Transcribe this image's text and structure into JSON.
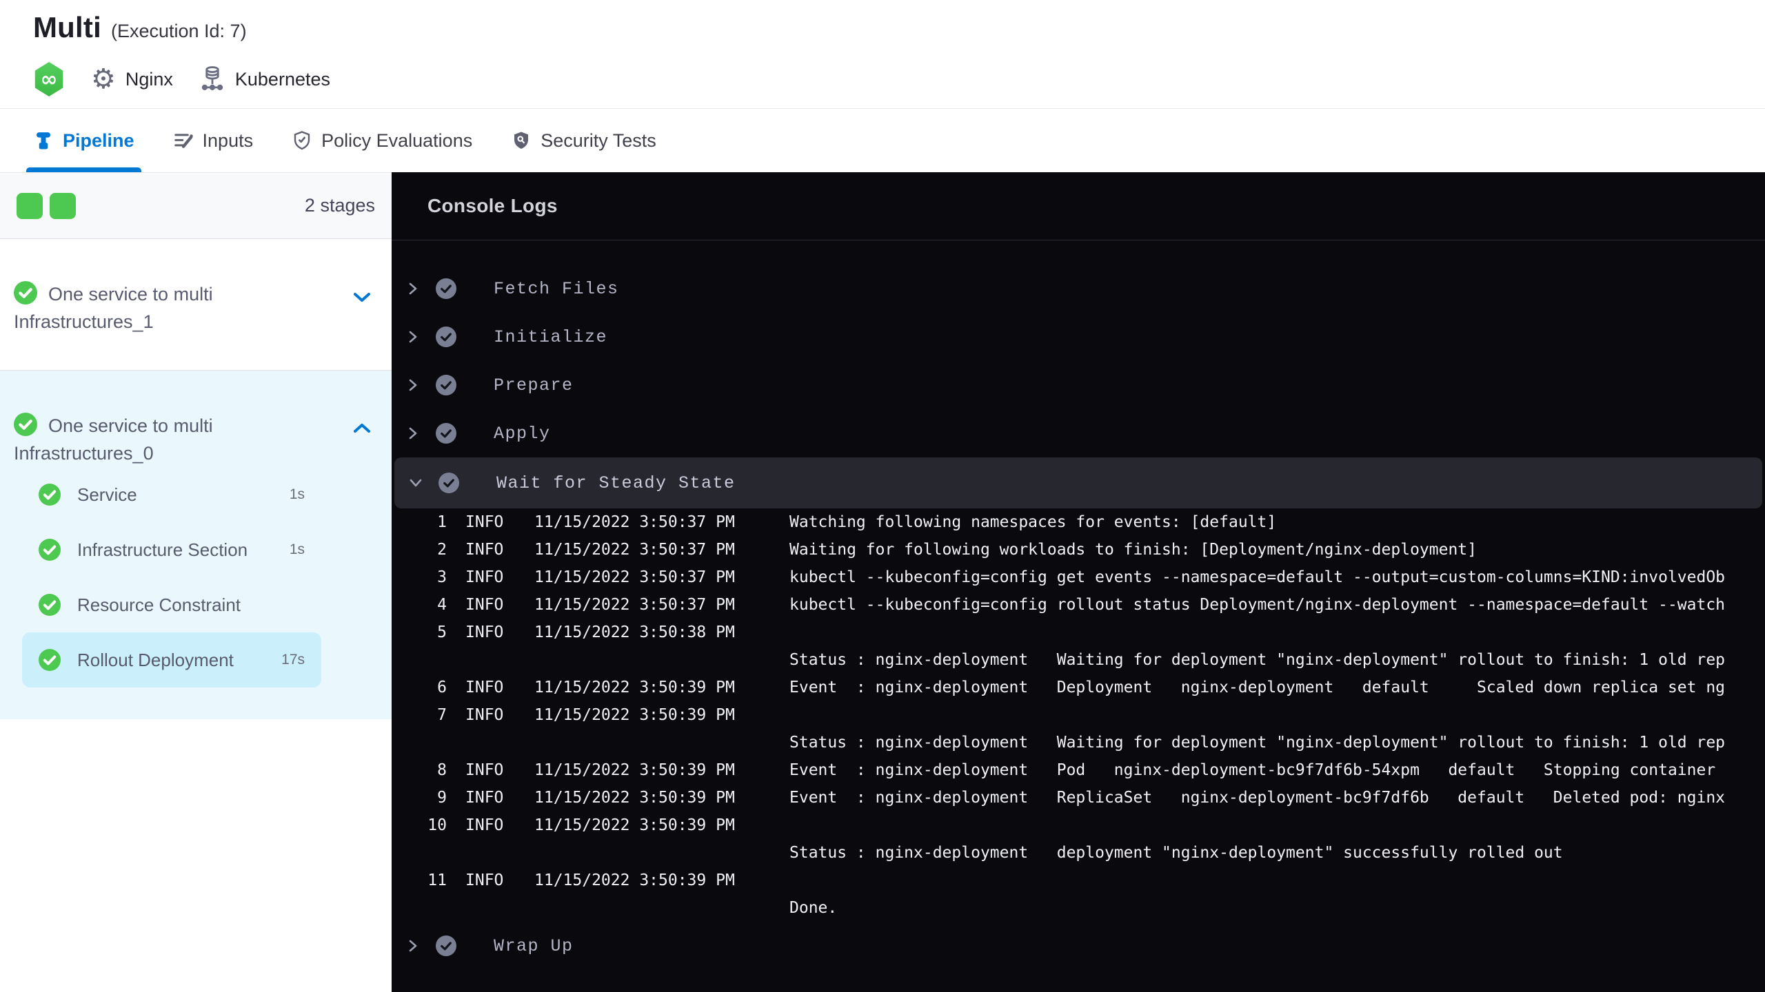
{
  "header": {
    "title": "Multi",
    "execution_id": "(Execution Id: 7)",
    "service_label": "Nginx",
    "infrastructure_label": "Kubernetes",
    "stage_type_icon": "infinity-hexagon-icon"
  },
  "tabs": [
    {
      "label": "Pipeline",
      "icon": "pipeline-icon",
      "active": true
    },
    {
      "label": "Inputs",
      "icon": "inputs-icon",
      "active": false
    },
    {
      "label": "Policy Evaluations",
      "icon": "shield-check-icon",
      "active": false
    },
    {
      "label": "Security Tests",
      "icon": "shield-search-icon",
      "active": false
    }
  ],
  "sidebar": {
    "stages_summary": {
      "count_label": "2 stages",
      "square_count": 2
    },
    "stages": [
      {
        "name": "One service to multi Infrastructures_1",
        "status": "success",
        "expanded": false
      },
      {
        "name": "One service to multi Infrastructures_0",
        "status": "success",
        "expanded": true,
        "steps": [
          {
            "label": "Service",
            "duration": "1s",
            "status": "success",
            "selected": false
          },
          {
            "label": "Infrastructure Section",
            "duration": "1s",
            "status": "success",
            "selected": false
          },
          {
            "label": "Resource Constraint",
            "duration": "",
            "status": "success",
            "selected": false
          },
          {
            "label": "Rollout Deployment",
            "duration": "17s",
            "status": "success",
            "selected": true
          }
        ]
      }
    ]
  },
  "console": {
    "title": "Console Logs",
    "sections": [
      {
        "label": "Fetch Files",
        "status": "success",
        "expanded": false
      },
      {
        "label": "Initialize",
        "status": "success",
        "expanded": false
      },
      {
        "label": "Prepare",
        "status": "success",
        "expanded": false
      },
      {
        "label": "Apply",
        "status": "success",
        "expanded": false
      },
      {
        "label": "Wait for Steady State",
        "status": "success",
        "expanded": true,
        "logs": [
          {
            "num": "1",
            "level": "INFO",
            "time": "11/15/2022 3:50:37 PM",
            "message": "Watching following namespaces for events: [default]"
          },
          {
            "num": "2",
            "level": "INFO",
            "time": "11/15/2022 3:50:37 PM",
            "message": "Waiting for following workloads to finish: [Deployment/nginx-deployment]"
          },
          {
            "num": "3",
            "level": "INFO",
            "time": "11/15/2022 3:50:37 PM",
            "message": "kubectl --kubeconfig=config get events --namespace=default --output=custom-columns=KIND:involvedOb"
          },
          {
            "num": "4",
            "level": "INFO",
            "time": "11/15/2022 3:50:37 PM",
            "message": "kubectl --kubeconfig=config rollout status Deployment/nginx-deployment --namespace=default --watch"
          },
          {
            "num": "5",
            "level": "INFO",
            "time": "11/15/2022 3:50:38 PM",
            "message": ""
          },
          {
            "num": "",
            "level": "",
            "time": "",
            "message": "Status : nginx-deployment   Waiting for deployment \"nginx-deployment\" rollout to finish: 1 old rep"
          },
          {
            "num": "6",
            "level": "INFO",
            "time": "11/15/2022 3:50:39 PM",
            "message": "Event  : nginx-deployment   Deployment   nginx-deployment   default     Scaled down replica set ng"
          },
          {
            "num": "7",
            "level": "INFO",
            "time": "11/15/2022 3:50:39 PM",
            "message": ""
          },
          {
            "num": "",
            "level": "",
            "time": "",
            "message": "Status : nginx-deployment   Waiting for deployment \"nginx-deployment\" rollout to finish: 1 old rep"
          },
          {
            "num": "8",
            "level": "INFO",
            "time": "11/15/2022 3:50:39 PM",
            "message": "Event  : nginx-deployment   Pod   nginx-deployment-bc9f7df6b-54xpm   default   Stopping container "
          },
          {
            "num": "9",
            "level": "INFO",
            "time": "11/15/2022 3:50:39 PM",
            "message": "Event  : nginx-deployment   ReplicaSet   nginx-deployment-bc9f7df6b   default   Deleted pod: nginx"
          },
          {
            "num": "10",
            "level": "INFO",
            "time": "11/15/2022 3:50:39 PM",
            "message": ""
          },
          {
            "num": "",
            "level": "",
            "time": "",
            "message": "Status : nginx-deployment   deployment \"nginx-deployment\" successfully rolled out"
          },
          {
            "num": "11",
            "level": "INFO",
            "time": "11/15/2022 3:50:39 PM",
            "message": ""
          },
          {
            "num": "",
            "level": "",
            "time": "",
            "message": "Done."
          }
        ]
      },
      {
        "label": "Wrap Up",
        "status": "success",
        "expanded": false
      }
    ]
  },
  "colors": {
    "accent_blue": "#0278d5",
    "success_green": "#4dc952",
    "console_bg": "#0a0a0e",
    "console_highlight": "#26272f",
    "expanded_stage_bg": "#eaf8fd",
    "selected_step_bg": "#cbf0fb"
  }
}
